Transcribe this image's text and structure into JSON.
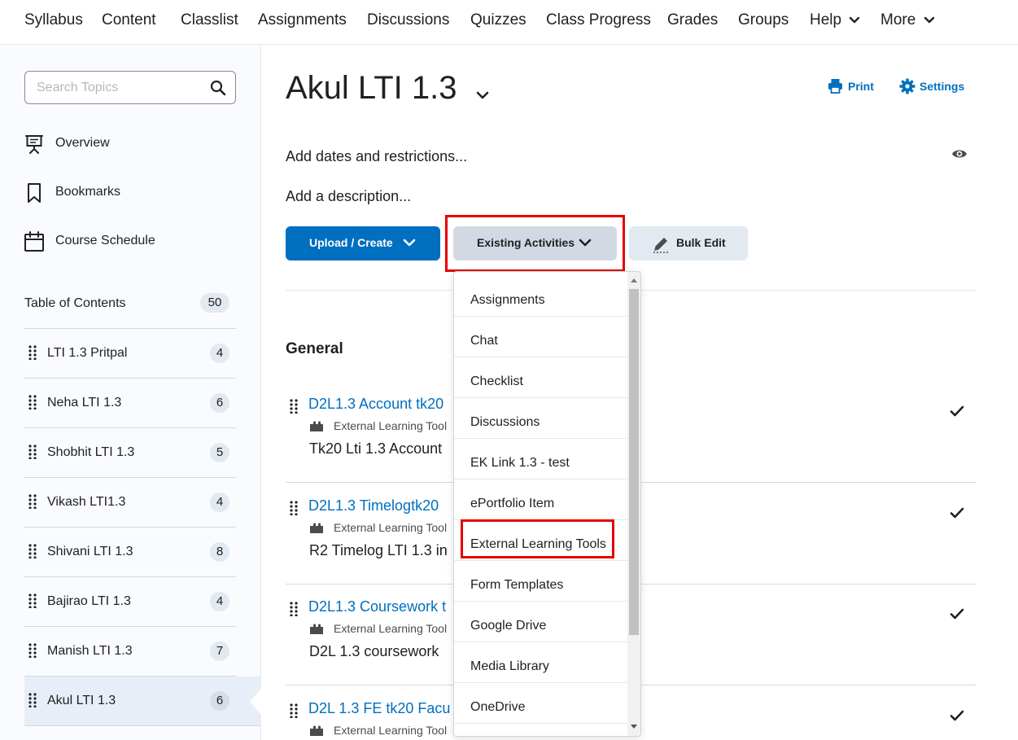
{
  "nav": {
    "items": [
      {
        "label": "Syllabus"
      },
      {
        "label": "Content"
      },
      {
        "label": "Classlist"
      },
      {
        "label": "Assignments"
      },
      {
        "label": "Discussions"
      },
      {
        "label": "Quizzes"
      },
      {
        "label": "Class Progress"
      },
      {
        "label": "Grades"
      },
      {
        "label": "Groups"
      },
      {
        "label": "Help"
      },
      {
        "label": "More"
      }
    ]
  },
  "sidebar": {
    "search_placeholder": "Search Topics",
    "links": [
      {
        "label": "Overview"
      },
      {
        "label": "Bookmarks"
      },
      {
        "label": "Course Schedule"
      }
    ],
    "toc": {
      "label": "Table of Contents",
      "count": "50"
    },
    "modules": [
      {
        "label": "LTI 1.3 Pritpal",
        "count": "4"
      },
      {
        "label": "Neha LTI 1.3",
        "count": "6"
      },
      {
        "label": "Shobhit LTI 1.3",
        "count": "5"
      },
      {
        "label": "Vikash LTI1.3",
        "count": "4"
      },
      {
        "label": "Shivani LTI 1.3",
        "count": "8"
      },
      {
        "label": "Bajirao LTI 1.3",
        "count": "4"
      },
      {
        "label": "Manish LTI 1.3",
        "count": "7"
      },
      {
        "label": "Akul LTI 1.3",
        "count": "6"
      }
    ]
  },
  "main": {
    "title": "Akul LTI 1.3",
    "print_label": "Print",
    "settings_label": "Settings",
    "dates_label": "Add dates and restrictions...",
    "description_label": "Add a description...",
    "upload_label": "Upload / Create",
    "existing_label": "Existing Activities",
    "bulk_edit_label": "Bulk Edit",
    "section_title": "General",
    "topics": [
      {
        "title": "D2L1.3 Account tk20",
        "type": "External Learning Tool",
        "desc": "Tk20 Lti 1.3 Account"
      },
      {
        "title": "D2L1.3 Timelogtk20",
        "type": "External Learning Tool",
        "desc": "R2 Timelog LTI 1.3 in"
      },
      {
        "title": "D2L1.3 Coursework t",
        "type": "External Learning Tool",
        "desc": "D2L 1.3 coursework"
      },
      {
        "title": "D2L 1.3 FE tk20 Facu",
        "type": "External Learning Tool",
        "desc": ""
      }
    ]
  },
  "dropdown": {
    "items": [
      {
        "label": "Assignments"
      },
      {
        "label": "Chat"
      },
      {
        "label": "Checklist"
      },
      {
        "label": "Discussions"
      },
      {
        "label": "EK Link 1.3 - test"
      },
      {
        "label": "ePortfolio Item"
      },
      {
        "label": "External Learning Tools"
      },
      {
        "label": "Form Templates"
      },
      {
        "label": "Google Drive"
      },
      {
        "label": "Media Library"
      },
      {
        "label": "OneDrive"
      }
    ]
  },
  "colors": {
    "brand_blue": "#006fbf",
    "highlight_red": "#e60000",
    "secondary_button": "#d3d9e3"
  }
}
